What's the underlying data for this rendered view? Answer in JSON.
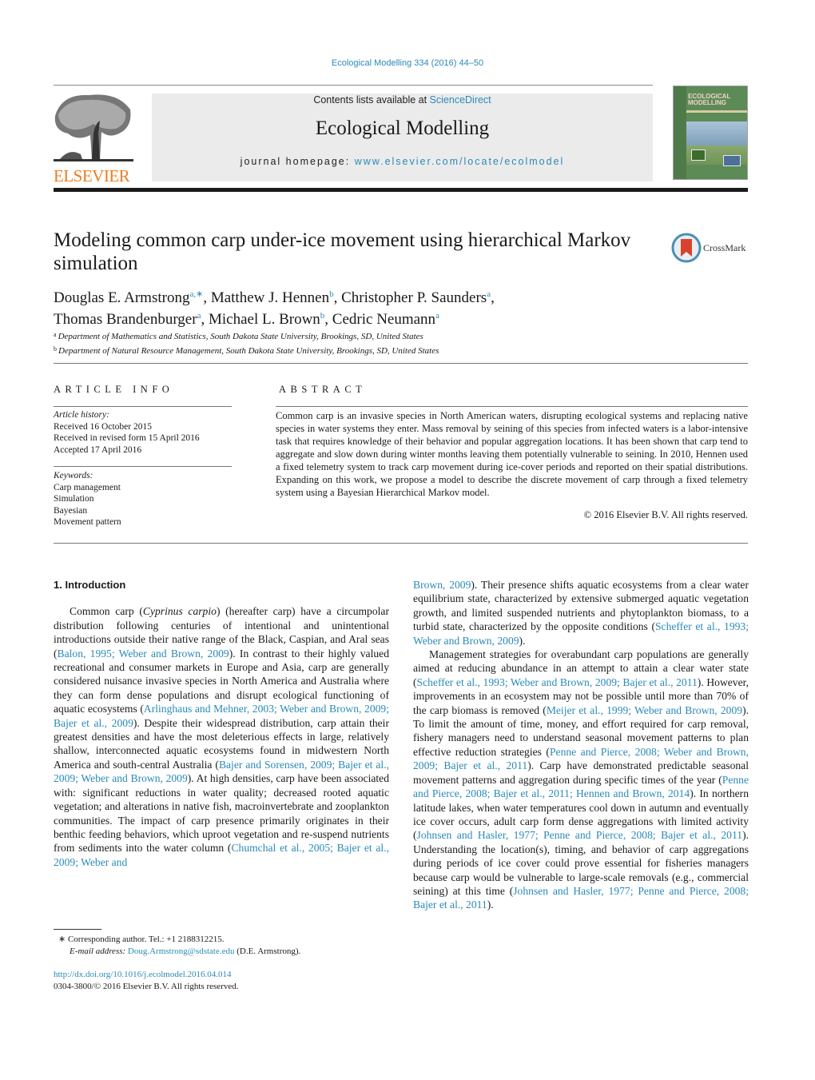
{
  "header": {
    "journal_ref": "Ecological Modelling 334 (2016) 44–50",
    "contents_prefix": "Contents lists available at ",
    "contents_link": "ScienceDirect",
    "journal_title": "Ecological Modelling",
    "homepage_prefix": "journal homepage: ",
    "homepage_link": "www.elsevier.com/locate/ecolmodel",
    "publisher_logo": "ELSEVIER",
    "cover_title_line1": "ECOLOGICAL",
    "cover_title_line2": "MODELLING",
    "crossmark_label": "CrossMark"
  },
  "colors": {
    "link": "#2a8ab8",
    "elsevier_orange": "#f07b20",
    "masthead_bg": "#ebebeb",
    "cover_green": "#5d8b57"
  },
  "article": {
    "title": "Modeling common carp under-ice movement using hierarchical Markov simulation",
    "authors": [
      {
        "name": "Douglas E. Armstrong",
        "sup": "a,∗"
      },
      {
        "name": "Matthew J. Hennen",
        "sup": "b"
      },
      {
        "name": "Christopher P. Saunders",
        "sup": "a"
      },
      {
        "name": "Thomas Brandenburger",
        "sup": "a"
      },
      {
        "name": "Michael L. Brown",
        "sup": "b"
      },
      {
        "name": "Cedric Neumann",
        "sup": "a"
      }
    ],
    "affiliations": [
      {
        "key": "a",
        "text": "Department of Mathematics and Statistics, South Dakota State University, Brookings, SD, United States"
      },
      {
        "key": "b",
        "text": "Department of Natural Resource Management, South Dakota State University, Brookings, SD, United States"
      }
    ]
  },
  "article_info": {
    "heading": "ARTICLE INFO",
    "history_label": "Article history:",
    "history": [
      "Received 16 October 2015",
      "Received in revised form 15 April 2016",
      "Accepted 17 April 2016"
    ],
    "keywords_label": "Keywords:",
    "keywords": [
      "Carp management",
      "Simulation",
      "Bayesian",
      "Movement pattern"
    ]
  },
  "abstract": {
    "heading": "ABSTRACT",
    "text": "Common carp is an invasive species in North American waters, disrupting ecological systems and replacing native species in water systems they enter. Mass removal by seining of this species from infected waters is a labor-intensive task that requires knowledge of their behavior and popular aggregation locations. It has been shown that carp tend to aggregate and slow down during winter months leaving them potentially vulnerable to seining. In 2010, Hennen used a fixed telemetry system to track carp movement during ice-cover periods and reported on their spatial distributions. Expanding on this work, we propose a model to describe the discrete movement of carp through a fixed telemetry system using a Bayesian Hierarchical Markov model.",
    "copyright": "© 2016 Elsevier B.V. All rights reserved."
  },
  "body": {
    "section_heading": "1.  Introduction",
    "left_paragraph": [
      {
        "t": "Common carp ("
      },
      {
        "t": "Cyprinus carpio",
        "i": true
      },
      {
        "t": ") (hereafter carp) have a circumpolar distribution following centuries of intentional and unintentional introductions outside their native range of the Black, Caspian, and Aral seas ("
      },
      {
        "t": "Balon, 1995; Weber and Brown, 2009",
        "l": true
      },
      {
        "t": "). In contrast to their highly valued recreational and consumer markets in Europe and Asia, carp are generally considered nuisance invasive species in North America and Australia where they can form dense populations and disrupt ecological functioning of aquatic ecosystems ("
      },
      {
        "t": "Arlinghaus and Mehner, 2003; Weber and Brown, 2009; Bajer et al., 2009",
        "l": true
      },
      {
        "t": "). Despite their widespread distribution, carp attain their greatest densities and have the most deleterious effects in large, relatively shallow, interconnected aquatic ecosystems found in midwestern North America and south-central Australia ("
      },
      {
        "t": "Bajer and Sorensen, 2009; Bajer et al., 2009; Weber and Brown, 2009",
        "l": true
      },
      {
        "t": "). At high densities, carp have been associated with: significant reductions in water quality; decreased rooted aquatic vegetation; and alterations in native fish, macroinvertebrate and zooplankton communities. The impact of carp presence primarily originates in their benthic feeding behaviors, which uproot vegetation and re-suspend nutrients from sediments into the water column ("
      },
      {
        "t": "Chumchal et al., 2005; Bajer et al., 2009; Weber and",
        "l": true
      }
    ],
    "right_paragraph_1": [
      {
        "t": "Brown, 2009",
        "l": true
      },
      {
        "t": "). Their presence shifts aquatic ecosystems from a clear water equilibrium state, characterized by extensive submerged aquatic vegetation growth, and limited suspended nutrients and phytoplankton biomass, to a turbid state, characterized by the opposite conditions ("
      },
      {
        "t": "Scheffer et al., 1993; Weber and Brown, 2009",
        "l": true
      },
      {
        "t": ")."
      }
    ],
    "right_paragraph_2": [
      {
        "t": "Management strategies for overabundant carp populations are generally aimed at reducing abundance in an attempt to attain a clear water state ("
      },
      {
        "t": "Scheffer et al., 1993; Weber and Brown, 2009; Bajer et al., 2011",
        "l": true
      },
      {
        "t": "). However, improvements in an ecosystem may not be possible until more than 70% of the carp biomass is removed ("
      },
      {
        "t": "Meijer et al., 1999; Weber and Brown, 2009",
        "l": true
      },
      {
        "t": "). To limit the amount of time, money, and effort required for carp removal, fishery managers need to understand seasonal movement patterns to plan effective reduction strategies ("
      },
      {
        "t": "Penne and Pierce, 2008; Weber and Brown, 2009; Bajer et al., 2011",
        "l": true
      },
      {
        "t": "). Carp have demonstrated predictable seasonal movement patterns and aggregation during specific times of the year ("
      },
      {
        "t": "Penne and Pierce, 2008; Bajer et al., 2011; Hennen and Brown, 2014",
        "l": true
      },
      {
        "t": "). In northern latitude lakes, when water temperatures cool down in autumn and eventually ice cover occurs, adult carp form dense aggregations with limited activity ("
      },
      {
        "t": "Johnsen and Hasler, 1977; Penne and Pierce, 2008; Bajer et al., 2011",
        "l": true
      },
      {
        "t": "). Understanding the location(s), timing, and behavior of carp aggregations during periods of ice cover could prove essential for fisheries managers because carp would be vulnerable to large-scale removals (e.g., commercial seining) at this time ("
      },
      {
        "t": "Johnsen and Hasler, 1977; Penne and Pierce, 2008; Bajer et al., 2011",
        "l": true
      },
      {
        "t": ")."
      }
    ]
  },
  "footnotes": {
    "corresponding": "∗  Corresponding author. Tel.: +1 2188312215.",
    "email_label": "E-mail address: ",
    "email": "Doug.Armstrong@sdstate.edu",
    "email_suffix": " (D.E. Armstrong).",
    "doi": "http://dx.doi.org/10.1016/j.ecolmodel.2016.04.014",
    "issn": "0304-3800/© 2016 Elsevier B.V. All rights reserved."
  }
}
